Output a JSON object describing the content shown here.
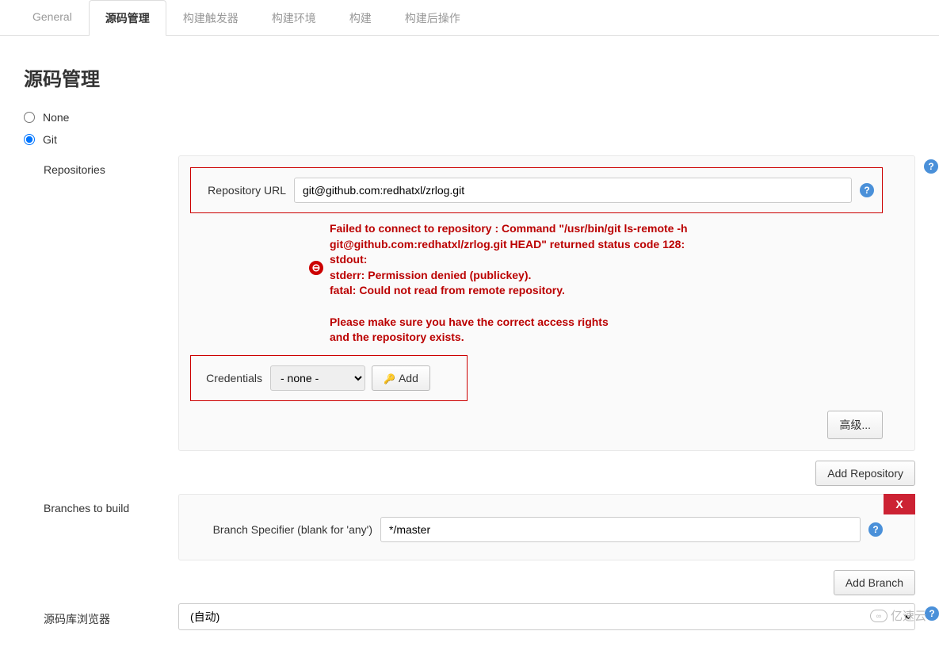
{
  "tabs": [
    {
      "label": "General",
      "active": false
    },
    {
      "label": "源码管理",
      "active": true
    },
    {
      "label": "构建触发器",
      "active": false
    },
    {
      "label": "构建环境",
      "active": false
    },
    {
      "label": "构建",
      "active": false
    },
    {
      "label": "构建后操作",
      "active": false
    }
  ],
  "section_title": "源码管理",
  "scm": {
    "none_label": "None",
    "git_label": "Git",
    "selected": "git"
  },
  "repositories": {
    "label": "Repositories",
    "repo_url_label": "Repository URL",
    "repo_url_value": "git@github.com:redhatxl/zrlog.git",
    "error_text": "Failed to connect to repository : Command \"/usr/bin/git ls-remote -h\ngit@github.com:redhatxl/zrlog.git HEAD\" returned status code 128:\nstdout:\nstderr: Permission denied (publickey).\nfatal: Could not read from remote repository.\n\nPlease make sure you have the correct access rights\nand the repository exists.",
    "credentials_label": "Credentials",
    "credentials_value": "- none -",
    "add_cred_label": "Add",
    "advanced_label": "高级...",
    "add_repo_label": "Add Repository"
  },
  "branches": {
    "label": "Branches to build",
    "specifier_label": "Branch Specifier (blank for 'any')",
    "specifier_value": "*/master",
    "add_branch_label": "Add Branch",
    "delete_label": "X"
  },
  "browser": {
    "label": "源码库浏览器",
    "value": "(自动)"
  },
  "watermark": "亿速云"
}
